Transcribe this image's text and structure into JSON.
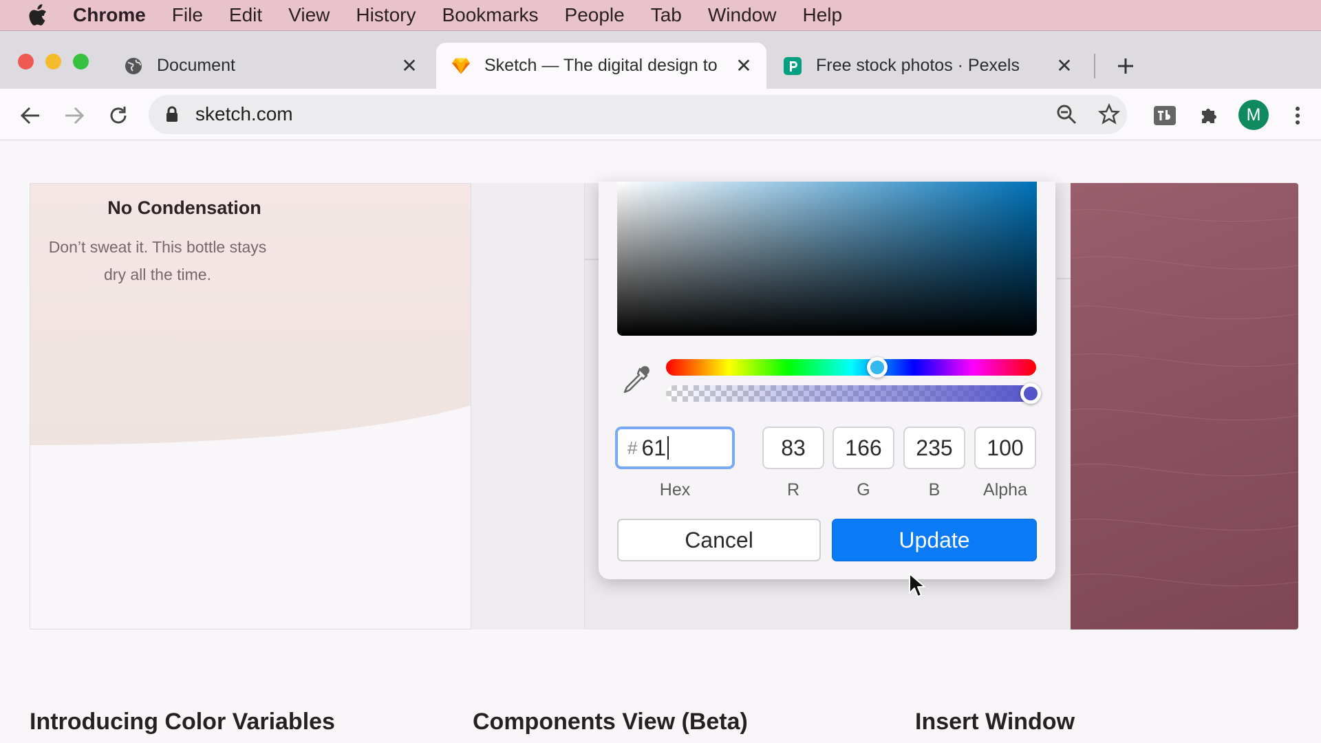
{
  "menubar": {
    "items": [
      "Chrome",
      "File",
      "Edit",
      "View",
      "History",
      "Bookmarks",
      "People",
      "Tab",
      "Window",
      "Help"
    ]
  },
  "tabs": [
    {
      "title": "Document",
      "icon": "globe-icon",
      "active": false
    },
    {
      "title": "Sketch — The digital design to",
      "icon": "sketch-diamond-icon",
      "active": true
    },
    {
      "title": "Free stock photos · Pexels",
      "icon": "pexels-icon",
      "active": false
    }
  ],
  "toolbar": {
    "url": "sketch.com",
    "avatar_letter": "M"
  },
  "card": {
    "title": "No Condensation",
    "text_line1": "Don’t sweat it. This bottle stays",
    "text_line2": "dry all the time."
  },
  "features": [
    "Introducing Color Variables",
    "Components View (Beta)",
    "Insert Window"
  ],
  "picker": {
    "hue_fraction": 0.57,
    "alpha_fraction": 1.0,
    "hex_prefix": "#",
    "hex_value": "61",
    "r": "83",
    "g": "166",
    "b": "235",
    "alpha": "100",
    "labels": {
      "hex": "Hex",
      "r": "R",
      "g": "G",
      "b": "B",
      "alpha": "Alpha"
    },
    "cancel_label": "Cancel",
    "update_label": "Update"
  },
  "colors": {
    "update_button": "#0a7af5",
    "menubar": "#e9c3cc",
    "avatar": "#0f8a5f"
  }
}
